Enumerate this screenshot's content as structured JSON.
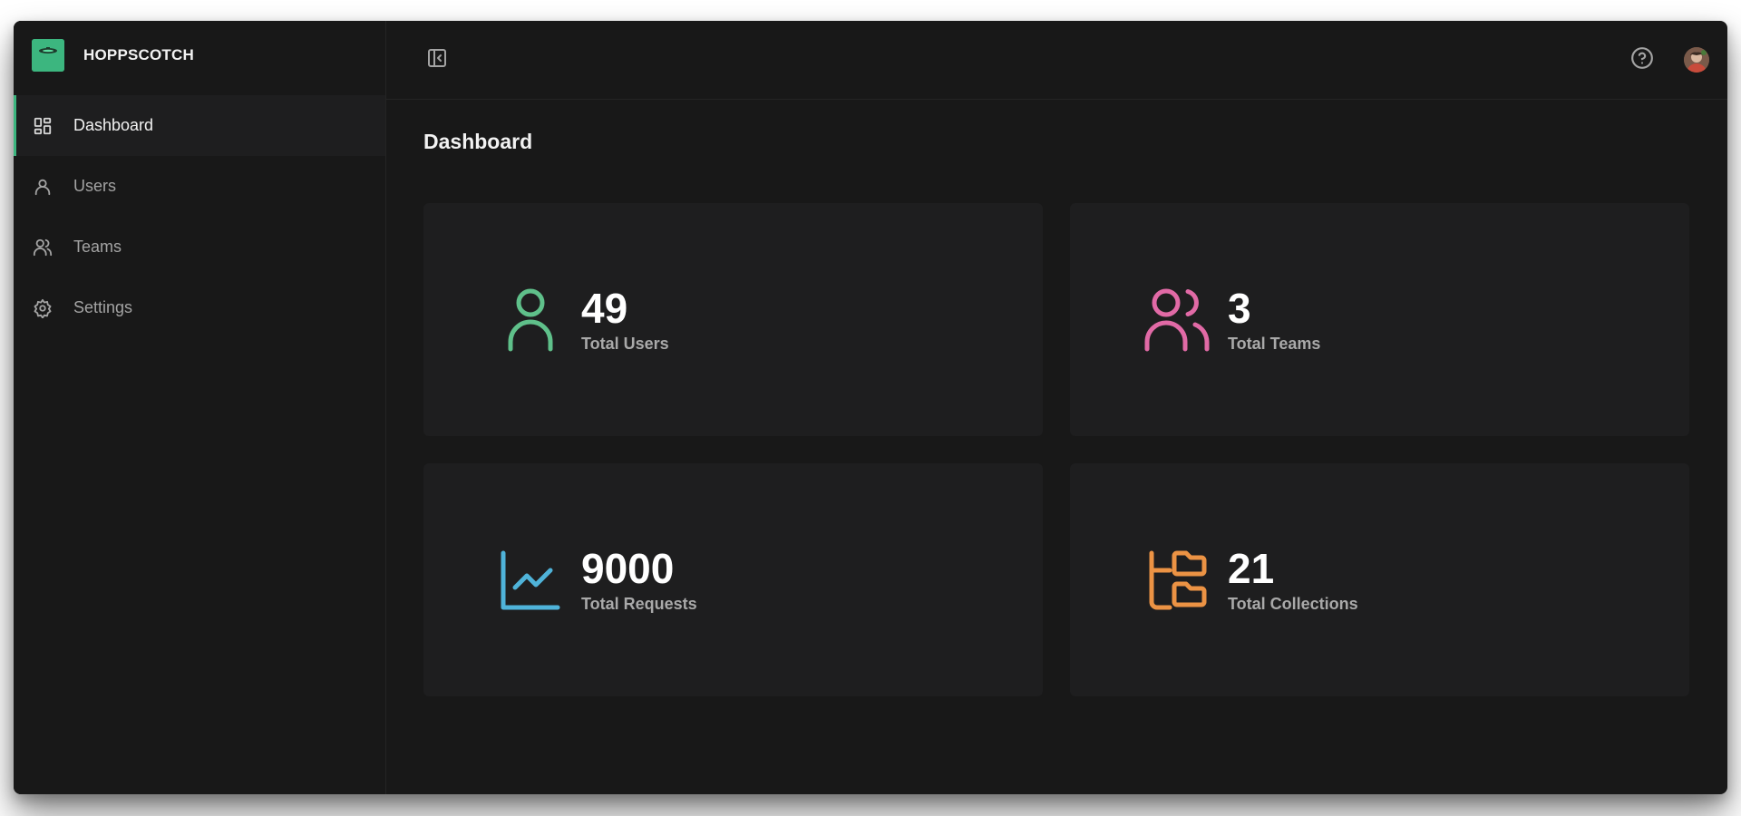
{
  "app": {
    "name": "HOPPSCOTCH",
    "logo_icon": "hoppscotch-logo",
    "accent_color": "#3cb67f"
  },
  "sidebar": {
    "items": [
      {
        "label": "Dashboard",
        "icon": "dashboard-icon",
        "active": true
      },
      {
        "label": "Users",
        "icon": "user-icon",
        "active": false
      },
      {
        "label": "Teams",
        "icon": "users-icon",
        "active": false
      },
      {
        "label": "Settings",
        "icon": "gear-icon",
        "active": false
      }
    ]
  },
  "topbar": {
    "collapse_icon": "sidebar-collapse-icon",
    "help_icon": "help-circle-icon",
    "avatar_icon": "avatar"
  },
  "main": {
    "title": "Dashboard",
    "cards": [
      {
        "value": "49",
        "label": "Total Users",
        "icon": "user-icon",
        "color": "#5fc08a"
      },
      {
        "value": "3",
        "label": "Total Teams",
        "icon": "users-icon",
        "color": "#e16aa6"
      },
      {
        "value": "9000",
        "label": "Total Requests",
        "icon": "line-chart-icon",
        "color": "#4fb3d9"
      },
      {
        "value": "21",
        "label": "Total Collections",
        "icon": "folder-tree-icon",
        "color": "#ec9344"
      }
    ]
  }
}
